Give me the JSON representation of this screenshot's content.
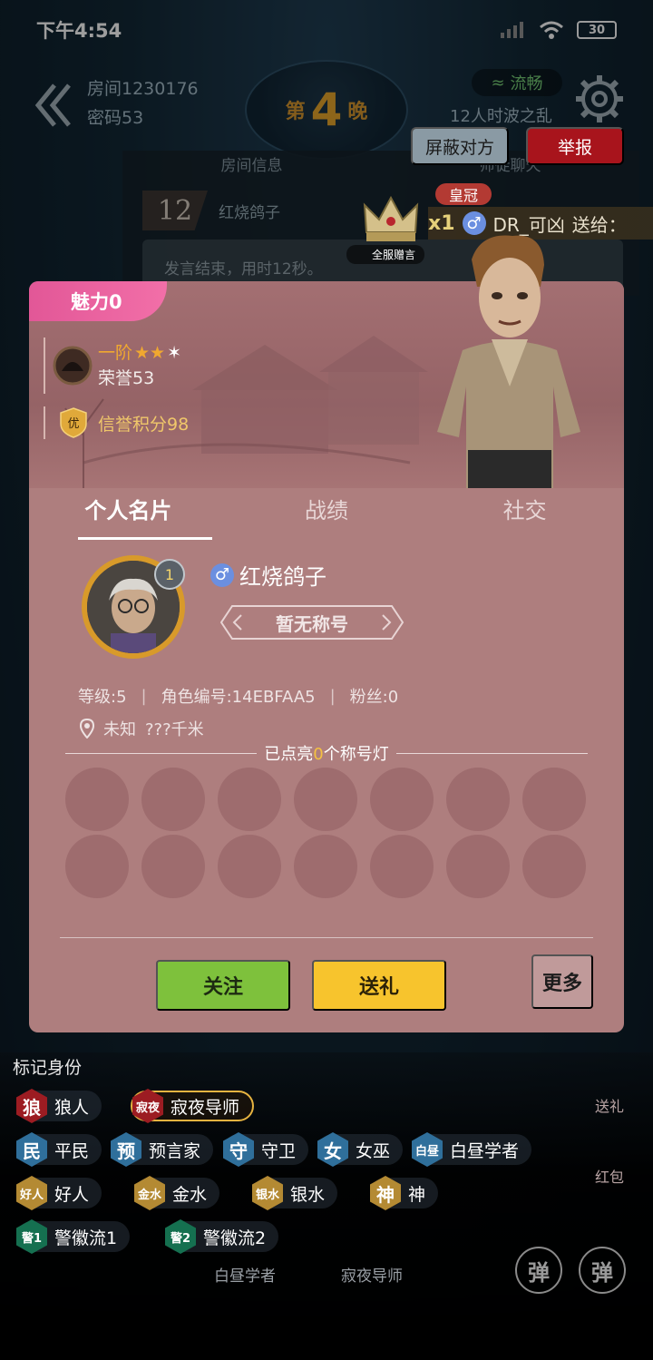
{
  "status_bar": {
    "time": "下午4:54",
    "battery": "30"
  },
  "header": {
    "room_label": "房间1230176",
    "password_label": "密码53",
    "night_prefix": "第",
    "night_number": "4",
    "night_suffix": "晚",
    "network": "流畅",
    "mode": "12人时波之乱",
    "block_button": "屏蔽对方",
    "report_button": "举报"
  },
  "chat": {
    "tabs": [
      "房间信息",
      "师徒聊天"
    ],
    "seat": "12",
    "player": "红烧鸽子",
    "message": "发言结束，用时12秒。"
  },
  "gift_banner": {
    "tag": "皇冠",
    "count": "x1",
    "sender": "DR_可凶",
    "to": "送给：",
    "hint": "全服赠言"
  },
  "profile": {
    "charm": "魅力0",
    "rank_level": "一阶",
    "honor": "荣誉53",
    "credit_badge": "优",
    "credit": "信誉积分98",
    "tabs": [
      "个人名片",
      "战绩",
      "社交"
    ],
    "avatar_level": "1",
    "name": "红烧鸽子",
    "title": "暂无称号",
    "level": "等级:5",
    "role_id": "角色编号:14EBFAA5",
    "fans": "粉丝:0",
    "location": "未知",
    "distance": "???千米",
    "lamps_prefix": "已点亮",
    "lamps_count": "0",
    "lamps_suffix": "个称号灯",
    "follow_button": "关注",
    "gift_button": "送礼",
    "more_button": "更多"
  },
  "mark_panel": {
    "title": "标记身份",
    "roles": [
      {
        "icon": "狼",
        "label": "狼人"
      },
      {
        "icon": "寂夜",
        "label": "寂夜导师"
      },
      {
        "icon": "民",
        "label": "平民"
      },
      {
        "icon": "预",
        "label": "预言家"
      },
      {
        "icon": "守",
        "label": "守卫"
      },
      {
        "icon": "女",
        "label": "女巫"
      },
      {
        "icon": "白昼",
        "label": "白昼学者"
      },
      {
        "icon": "好人",
        "label": "好人"
      },
      {
        "icon": "金水",
        "label": "金水"
      },
      {
        "icon": "银水",
        "label": "银水"
      },
      {
        "icon": "神",
        "label": "神"
      },
      {
        "icon": "警1",
        "label": "警徽流1"
      },
      {
        "icon": "警2",
        "label": "警徽流2"
      }
    ],
    "bottom_labels": [
      "白昼学者",
      "寂夜导师"
    ],
    "danmu": "弹",
    "side_gift": "送礼",
    "side_redpack": "红包"
  },
  "colors": {
    "card_bg": "#ae7e7e",
    "charm_tab": "#e25797",
    "follow": "#7ec13c",
    "gift": "#f7c42d",
    "report": "#a8141c"
  }
}
